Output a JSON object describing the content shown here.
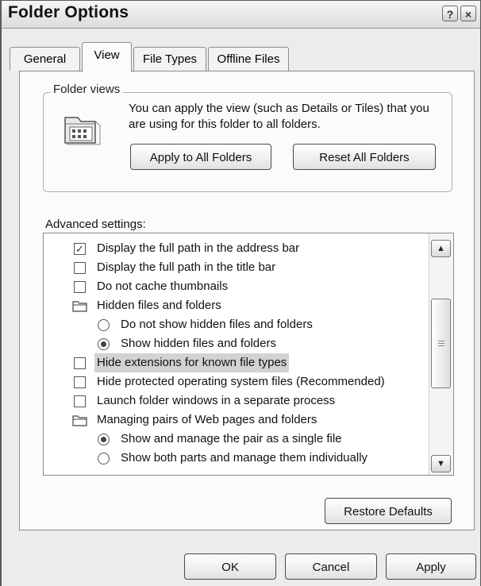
{
  "window": {
    "title": "Folder Options",
    "help_glyph": "?",
    "close_glyph": "×"
  },
  "tabs": [
    {
      "label": "General",
      "active": false
    },
    {
      "label": "View",
      "active": true
    },
    {
      "label": "File Types",
      "active": false
    },
    {
      "label": "Offline Files",
      "active": false
    }
  ],
  "folder_views": {
    "group_label": "Folder views",
    "description": "You can apply the view (such as Details or Tiles) that you are using for this folder to all folders.",
    "apply_button": "Apply to All Folders",
    "reset_button": "Reset All Folders",
    "icon": "folder-icon"
  },
  "advanced": {
    "label": "Advanced settings:",
    "items": [
      {
        "kind": "checkbox",
        "label": "Display the full path in the address bar",
        "checked": true,
        "indent": 0
      },
      {
        "kind": "checkbox",
        "label": "Display the full path in the title bar",
        "checked": false,
        "indent": 0
      },
      {
        "kind": "checkbox",
        "label": "Do not cache thumbnails",
        "checked": false,
        "indent": 0
      },
      {
        "kind": "folder",
        "label": "Hidden files and folders",
        "indent": 0
      },
      {
        "kind": "radio",
        "label": "Do not show hidden files and folders",
        "checked": false,
        "indent": 1
      },
      {
        "kind": "radio",
        "label": "Show hidden files and folders",
        "checked": true,
        "indent": 1
      },
      {
        "kind": "checkbox",
        "label": "Hide extensions for known file types",
        "checked": false,
        "indent": 0,
        "selected": true
      },
      {
        "kind": "checkbox",
        "label": "Hide protected operating system files (Recommended)",
        "checked": false,
        "indent": 0
      },
      {
        "kind": "checkbox",
        "label": "Launch folder windows in a separate process",
        "checked": false,
        "indent": 0
      },
      {
        "kind": "folder",
        "label": "Managing pairs of Web pages and folders",
        "indent": 0
      },
      {
        "kind": "radio",
        "label": "Show and manage the pair as a single file",
        "checked": true,
        "indent": 1
      },
      {
        "kind": "radio",
        "label": "Show both parts and manage them individually",
        "checked": false,
        "indent": 1
      }
    ],
    "restore_button": "Restore Defaults"
  },
  "footer": {
    "ok": "OK",
    "cancel": "Cancel",
    "apply": "Apply"
  },
  "colors": {
    "window_bg": "#ececec",
    "panel_bg": "#fbfbfb",
    "selection": "#d2d2d2"
  }
}
